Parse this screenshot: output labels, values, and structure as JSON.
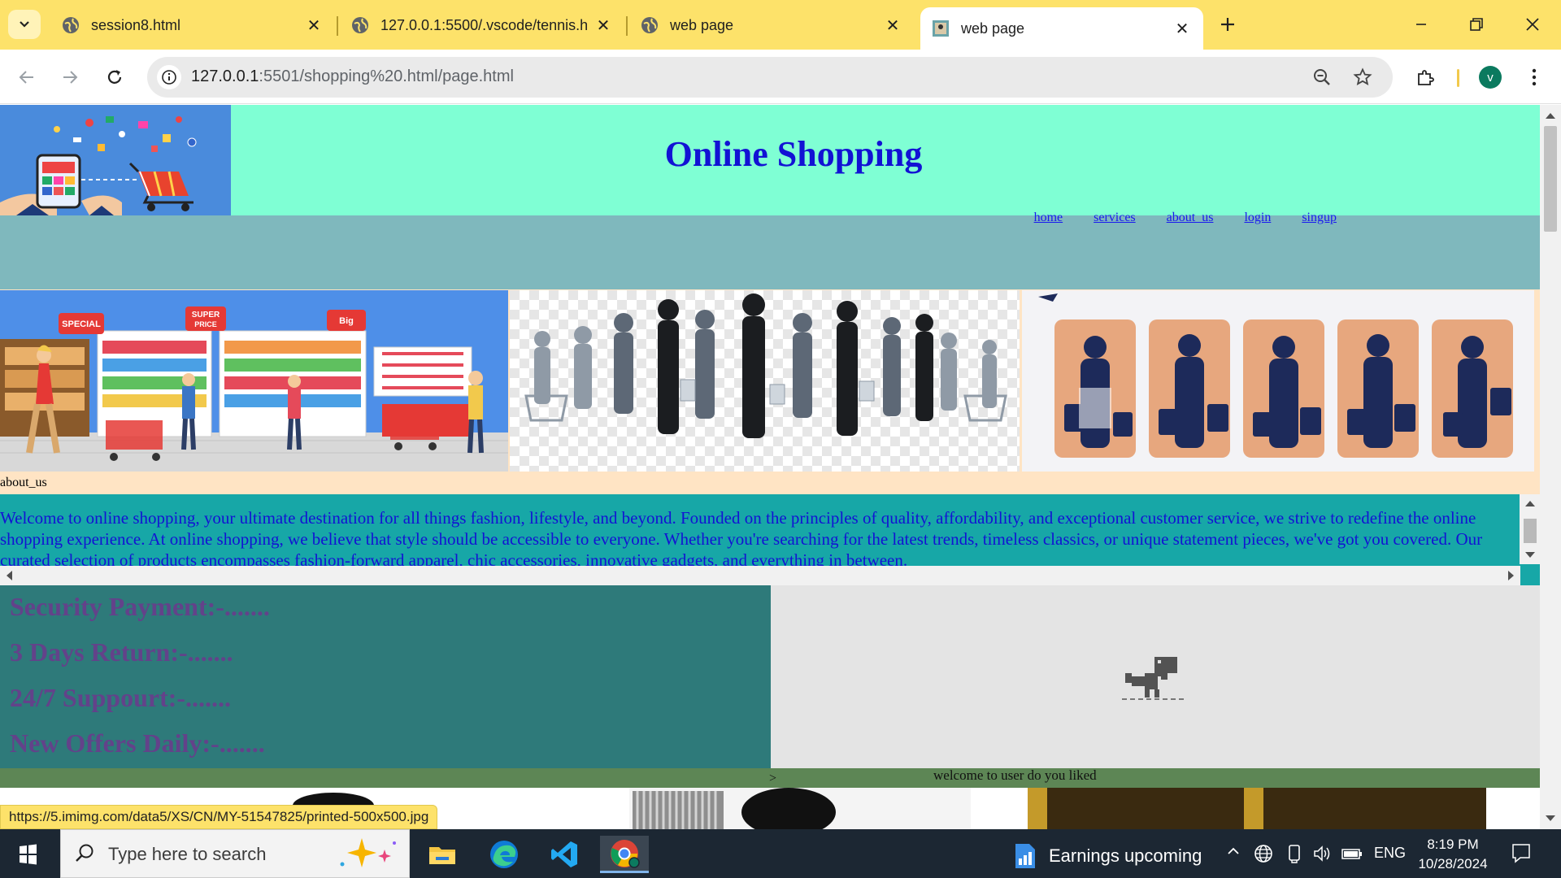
{
  "browser": {
    "tabs": [
      {
        "title": "session8.html"
      },
      {
        "title": "127.0.0.1:5500/.vscode/tennis.h"
      },
      {
        "title": "web page"
      },
      {
        "title": "web page",
        "active": true
      }
    ],
    "address": {
      "host": "127.0.0.1",
      "path": ":5501/shopping%20.html/page.html"
    },
    "profile_initial": "v",
    "status_url": "https://5.imimg.com/data5/XS/CN/MY-51547825/printed-500x500.jpg"
  },
  "page": {
    "title": "Online Shopping",
    "nav": {
      "home": "home",
      "services": "services",
      "about": "about_us",
      "login": "login",
      "signup": "singup"
    },
    "about_label": "about_us",
    "about_text": "Welcome to online shopping, your ultimate destination for all things fashion, lifestyle, and beyond. Founded on the principles of quality, affordability, and exceptional customer service, we strive to redefine the online shopping experience. At online shopping, we believe that style should be accessible to everyone. Whether you're searching for the latest trends, timeless classics, or unique statement pieces, we've got you covered. Our curated selection of products encompasses fashion-forward apparel, chic accessories, innovative gadgets, and everything in between.",
    "features": [
      "Security Payment:-.......",
      "3 Days Return:-.......",
      "24/7 Suppourt:-.......",
      "New Offers Daily:-......."
    ],
    "welcome_gt": ">",
    "welcome_text": "welcome to user do you liked",
    "banner_labels": {
      "special": "SPECIAL",
      "super": "SUPER",
      "super2": "PRICE",
      "big": "Big"
    }
  },
  "taskbar": {
    "search_placeholder": "Type here to search",
    "earnings": "Earnings upcoming",
    "lang": "ENG",
    "time": "8:19 PM",
    "date": "10/28/2024"
  },
  "colors": {
    "tabstrip": "#fde26a",
    "header": "#7fffd4",
    "nav_band": "#7fb8bd",
    "about_box": "#17a7a7",
    "features": "#2e7a7a",
    "title_blue": "#1212d4"
  }
}
